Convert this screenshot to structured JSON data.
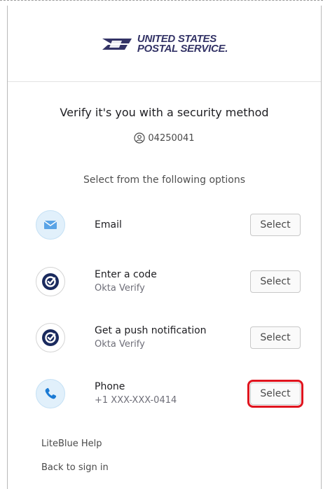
{
  "brand": {
    "line1": "UNITED STATES",
    "line2": "POSTAL SERVICE."
  },
  "title": "Verify it's you with a security method",
  "identifier": "04250041",
  "subtitle": "Select from the following options",
  "options": [
    {
      "label": "Email",
      "sub": "",
      "icon": "email-icon",
      "button": "Select"
    },
    {
      "label": "Enter a code",
      "sub": "Okta Verify",
      "icon": "okta-verify-icon",
      "button": "Select"
    },
    {
      "label": "Get a push notification",
      "sub": "Okta Verify",
      "icon": "okta-verify-icon",
      "button": "Select"
    },
    {
      "label": "Phone",
      "sub": "+1 XXX-XXX-0414",
      "icon": "phone-icon",
      "button": "Select"
    }
  ],
  "links": {
    "help": "LiteBlue Help",
    "back": "Back to sign in"
  },
  "colors": {
    "brand_blue": "#333366",
    "okta_navy": "#1a2a5e",
    "highlight_red": "#e0141e",
    "icon_bg": "#e1f0fb"
  }
}
